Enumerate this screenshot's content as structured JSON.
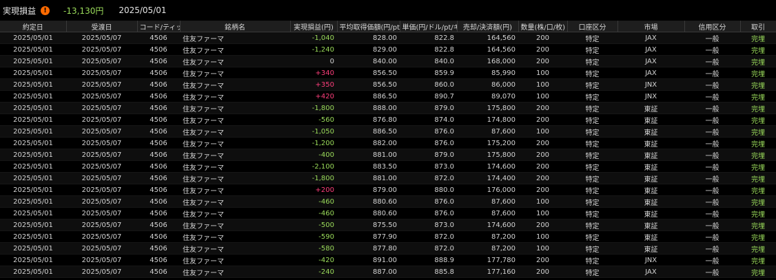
{
  "header": {
    "title": "実現損益",
    "info_icon": "!",
    "total": "-13,130円",
    "total_color": "#9bdc5b",
    "date": "2025/05/01"
  },
  "colors": {
    "negative": "#9bdc5b",
    "positive": "#ff3f7c",
    "status": "#9bdc5b"
  },
  "columns": [
    "約定日",
    "受渡日",
    "コード/ティッ...",
    "銘柄名",
    "実現損益(円)",
    "平均取得価額(円/pt)",
    "単価(円/ドル/pt/ギ...",
    "売却/決済額(円)",
    "数量(株/口/枚)",
    "口座区分",
    "市場",
    "信用区分",
    "取引"
  ],
  "rows": [
    {
      "trade": "2025/05/01",
      "settle": "2025/05/07",
      "code": "4506",
      "name": "住友ファーマ",
      "pl": "-1,040",
      "avg": "828.00",
      "price": "822.8",
      "amount": "164,560",
      "qty": "200",
      "account": "特定",
      "market": "JAX",
      "credit": "一般",
      "status": "完埋"
    },
    {
      "trade": "2025/05/01",
      "settle": "2025/05/07",
      "code": "4506",
      "name": "住友ファーマ",
      "pl": "-1,240",
      "avg": "829.00",
      "price": "822.8",
      "amount": "164,560",
      "qty": "200",
      "account": "特定",
      "market": "JAX",
      "credit": "一般",
      "status": "完埋"
    },
    {
      "trade": "2025/05/01",
      "settle": "2025/05/07",
      "code": "4506",
      "name": "住友ファーマ",
      "pl": "0",
      "avg": "840.00",
      "price": "840.0",
      "amount": "168,000",
      "qty": "200",
      "account": "特定",
      "market": "JAX",
      "credit": "一般",
      "status": "完埋"
    },
    {
      "trade": "2025/05/01",
      "settle": "2025/05/07",
      "code": "4506",
      "name": "住友ファーマ",
      "pl": "+340",
      "avg": "856.50",
      "price": "859.9",
      "amount": "85,990",
      "qty": "100",
      "account": "特定",
      "market": "JAX",
      "credit": "一般",
      "status": "完埋"
    },
    {
      "trade": "2025/05/01",
      "settle": "2025/05/07",
      "code": "4506",
      "name": "住友ファーマ",
      "pl": "+350",
      "avg": "856.50",
      "price": "860.0",
      "amount": "86,000",
      "qty": "100",
      "account": "特定",
      "market": "JNX",
      "credit": "一般",
      "status": "完埋"
    },
    {
      "trade": "2025/05/01",
      "settle": "2025/05/07",
      "code": "4506",
      "name": "住友ファーマ",
      "pl": "+420",
      "avg": "886.50",
      "price": "890.7",
      "amount": "89,070",
      "qty": "100",
      "account": "特定",
      "market": "JNX",
      "credit": "一般",
      "status": "完埋"
    },
    {
      "trade": "2025/05/01",
      "settle": "2025/05/07",
      "code": "4506",
      "name": "住友ファーマ",
      "pl": "-1,800",
      "avg": "888.00",
      "price": "879.0",
      "amount": "175,800",
      "qty": "200",
      "account": "特定",
      "market": "東証",
      "credit": "一般",
      "status": "完埋"
    },
    {
      "trade": "2025/05/01",
      "settle": "2025/05/07",
      "code": "4506",
      "name": "住友ファーマ",
      "pl": "-560",
      "avg": "876.80",
      "price": "874.0",
      "amount": "174,800",
      "qty": "200",
      "account": "特定",
      "market": "東証",
      "credit": "一般",
      "status": "完埋"
    },
    {
      "trade": "2025/05/01",
      "settle": "2025/05/07",
      "code": "4506",
      "name": "住友ファーマ",
      "pl": "-1,050",
      "avg": "886.50",
      "price": "876.0",
      "amount": "87,600",
      "qty": "100",
      "account": "特定",
      "market": "東証",
      "credit": "一般",
      "status": "完埋"
    },
    {
      "trade": "2025/05/01",
      "settle": "2025/05/07",
      "code": "4506",
      "name": "住友ファーマ",
      "pl": "-1,200",
      "avg": "882.00",
      "price": "876.0",
      "amount": "175,200",
      "qty": "200",
      "account": "特定",
      "market": "東証",
      "credit": "一般",
      "status": "完埋"
    },
    {
      "trade": "2025/05/01",
      "settle": "2025/05/07",
      "code": "4506",
      "name": "住友ファーマ",
      "pl": "-400",
      "avg": "881.00",
      "price": "879.0",
      "amount": "175,800",
      "qty": "200",
      "account": "特定",
      "market": "東証",
      "credit": "一般",
      "status": "完埋"
    },
    {
      "trade": "2025/05/01",
      "settle": "2025/05/07",
      "code": "4506",
      "name": "住友ファーマ",
      "pl": "-2,100",
      "avg": "883.50",
      "price": "873.0",
      "amount": "174,600",
      "qty": "200",
      "account": "特定",
      "market": "東証",
      "credit": "一般",
      "status": "完埋"
    },
    {
      "trade": "2025/05/01",
      "settle": "2025/05/07",
      "code": "4506",
      "name": "住友ファーマ",
      "pl": "-1,800",
      "avg": "881.00",
      "price": "872.0",
      "amount": "174,400",
      "qty": "200",
      "account": "特定",
      "market": "東証",
      "credit": "一般",
      "status": "完埋"
    },
    {
      "trade": "2025/05/01",
      "settle": "2025/05/07",
      "code": "4506",
      "name": "住友ファーマ",
      "pl": "+200",
      "avg": "879.00",
      "price": "880.0",
      "amount": "176,000",
      "qty": "200",
      "account": "特定",
      "market": "東証",
      "credit": "一般",
      "status": "完埋"
    },
    {
      "trade": "2025/05/01",
      "settle": "2025/05/07",
      "code": "4506",
      "name": "住友ファーマ",
      "pl": "-460",
      "avg": "880.60",
      "price": "876.0",
      "amount": "87,600",
      "qty": "100",
      "account": "特定",
      "market": "東証",
      "credit": "一般",
      "status": "完埋"
    },
    {
      "trade": "2025/05/01",
      "settle": "2025/05/07",
      "code": "4506",
      "name": "住友ファーマ",
      "pl": "-460",
      "avg": "880.60",
      "price": "876.0",
      "amount": "87,600",
      "qty": "100",
      "account": "特定",
      "market": "東証",
      "credit": "一般",
      "status": "完埋"
    },
    {
      "trade": "2025/05/01",
      "settle": "2025/05/07",
      "code": "4506",
      "name": "住友ファーマ",
      "pl": "-500",
      "avg": "875.50",
      "price": "873.0",
      "amount": "174,600",
      "qty": "200",
      "account": "特定",
      "market": "東証",
      "credit": "一般",
      "status": "完埋"
    },
    {
      "trade": "2025/05/01",
      "settle": "2025/05/07",
      "code": "4506",
      "name": "住友ファーマ",
      "pl": "-590",
      "avg": "877.90",
      "price": "872.0",
      "amount": "87,200",
      "qty": "100",
      "account": "特定",
      "market": "東証",
      "credit": "一般",
      "status": "完埋"
    },
    {
      "trade": "2025/05/01",
      "settle": "2025/05/07",
      "code": "4506",
      "name": "住友ファーマ",
      "pl": "-580",
      "avg": "877.80",
      "price": "872.0",
      "amount": "87,200",
      "qty": "100",
      "account": "特定",
      "market": "東証",
      "credit": "一般",
      "status": "完埋"
    },
    {
      "trade": "2025/05/01",
      "settle": "2025/05/07",
      "code": "4506",
      "name": "住友ファーマ",
      "pl": "-420",
      "avg": "891.00",
      "price": "888.9",
      "amount": "177,780",
      "qty": "200",
      "account": "特定",
      "market": "JNX",
      "credit": "一般",
      "status": "完埋"
    },
    {
      "trade": "2025/05/01",
      "settle": "2025/05/07",
      "code": "4506",
      "name": "住友ファーマ",
      "pl": "-240",
      "avg": "887.00",
      "price": "885.8",
      "amount": "177,160",
      "qty": "200",
      "account": "特定",
      "market": "JAX",
      "credit": "一般",
      "status": "完埋"
    }
  ]
}
